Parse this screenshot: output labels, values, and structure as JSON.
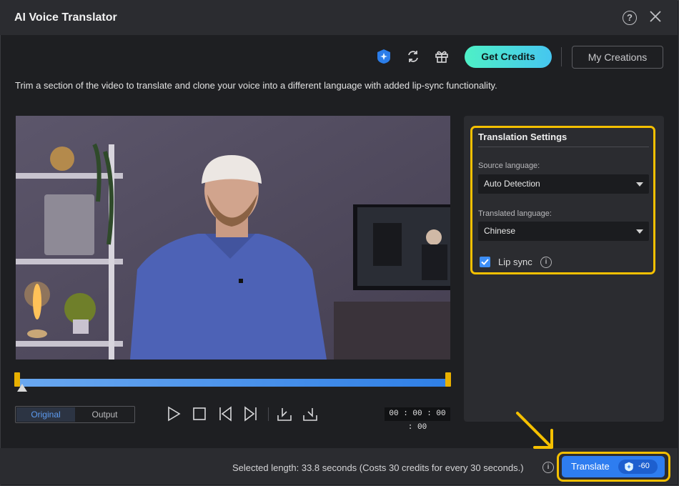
{
  "window": {
    "title": "AI Voice Translator"
  },
  "toolbar": {
    "icons": [
      "credits-badge-icon",
      "refresh-icon",
      "gift-icon"
    ],
    "get_credits": "Get Credits",
    "my_creations": "My Creations"
  },
  "description": "Trim a section of the video to translate and clone your voice into a different language with added lip-sync functionality.",
  "player": {
    "tabs": [
      "Original",
      "Output"
    ],
    "active_tab": "Original",
    "timecode": "00 : 00 : 00 : 00",
    "trim_start": 0,
    "trim_end": 1,
    "playhead": 0
  },
  "settings": {
    "title": "Translation Settings",
    "source_label": "Source language:",
    "source_value": "Auto Detection",
    "target_label": "Translated language:",
    "target_value": "Chinese",
    "lip_sync_label": "Lip sync",
    "lip_sync_checked": true
  },
  "footer": {
    "selected_length": "Selected length: 33.8 seconds (Costs 30 credits for every 30 seconds.)",
    "translate_label": "Translate",
    "credit_cost": "-60"
  },
  "colors": {
    "accent": "#2e7df0",
    "highlight": "#f5c000",
    "credits_gradient_start": "#4ef0c6",
    "credits_gradient_end": "#46c6f0"
  }
}
